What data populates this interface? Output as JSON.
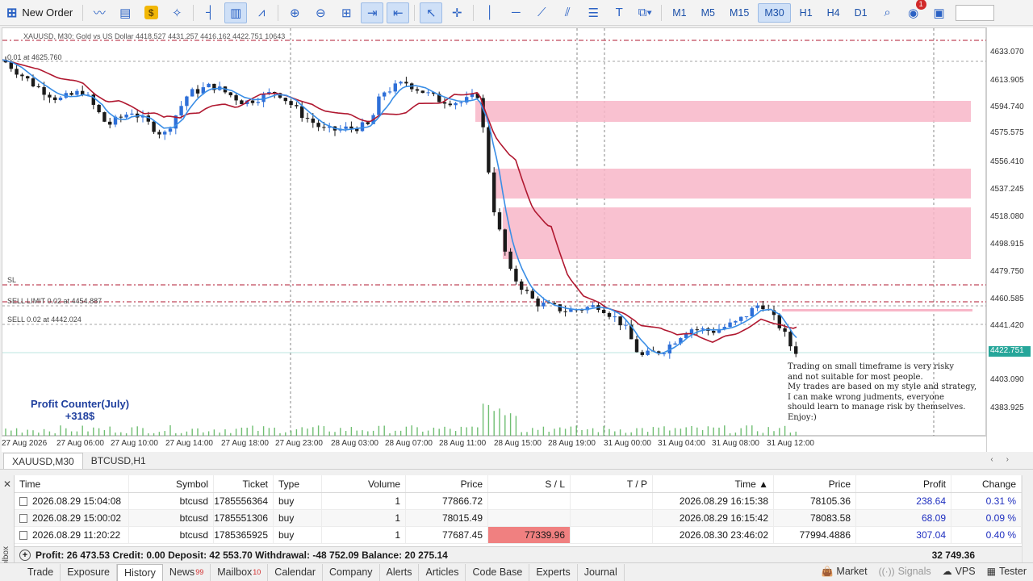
{
  "toolbar": {
    "new_order": "New Order",
    "timeframes": [
      "M1",
      "M5",
      "M15",
      "M30",
      "H1",
      "H4",
      "D1"
    ],
    "active_timeframe": "M30",
    "notification_count": "1"
  },
  "chart": {
    "title": "XAUUSD, M30:  Gold vs US Dollar  4418.527 4431.257 4416.162 4422.751  10643",
    "buy_label": "0.01 at 4625.760",
    "sl_label": "SL",
    "sell_limit_label": "SELL LIMIT 0.02 at 4454.887",
    "sell_label": "SELL 0.02 at 4442.024",
    "profit_counter_title": "Profit Counter(July)",
    "profit_counter_value": "+318$",
    "comment_lines": [
      "Trading on small timeframe is very risky",
      "and not suitable for most people.",
      "My trades are based on my style and strategy,",
      "I can make wrong judments, everyone",
      "should learn to manage risk by themselves.",
      "Enjoy:)"
    ],
    "price_ticks": [
      "4633.070",
      "4613.905",
      "4594.740",
      "4575.575",
      "4556.410",
      "4537.245",
      "4518.080",
      "4498.915",
      "4479.750",
      "4460.585",
      "4441.420",
      "4403.090",
      "4383.925"
    ],
    "current_price": "4422.751",
    "time_ticks": [
      "27 Aug 2026",
      "27 Aug 06:00",
      "27 Aug 10:00",
      "27 Aug 14:00",
      "27 Aug 18:00",
      "27 Aug 23:00",
      "28 Aug 03:00",
      "28 Aug 07:00",
      "28 Aug 11:00",
      "28 Aug 15:00",
      "28 Aug 19:00",
      "31 Aug 00:00",
      "31 Aug 04:00",
      "31 Aug 08:00",
      "31 Aug 12:00"
    ],
    "colors": {
      "bull": "#2e6fd8",
      "bear": "#1a1a1a",
      "fast_ma": "#3a8ee6",
      "slow_ma": "#b01830",
      "zone": "#f8b6c8",
      "current": "#26a69a"
    }
  },
  "chart_tabs": [
    "XAUUSD,M30",
    "BTCUSD,H1"
  ],
  "history": {
    "columns": [
      "Time",
      "Symbol",
      "Ticket",
      "Type",
      "Volume",
      "Price",
      "S / L",
      "T / P",
      "Time",
      "Price",
      "Profit",
      "Change"
    ],
    "rows": [
      [
        "2026.08.29 15:04:08",
        "btcusd",
        "1785556364",
        "buy",
        "1",
        "77866.72",
        "",
        "",
        "2026.08.29 16:15:38",
        "78105.36",
        "238.64",
        "0.31 %"
      ],
      [
        "2026.08.29 15:00:02",
        "btcusd",
        "1785551306",
        "buy",
        "1",
        "78015.49",
        "",
        "",
        "2026.08.29 16:15:42",
        "78083.58",
        "68.09",
        "0.09 %"
      ],
      [
        "2026.08.29 11:20:22",
        "btcusd",
        "1785365925",
        "buy",
        "1",
        "77687.45",
        "77339.96",
        "",
        "2026.08.30 23:46:02",
        "77994.4886",
        "307.04",
        "0.40 %"
      ]
    ],
    "summary": "Profit: 26 473.53  Credit: 0.00  Deposit: 42 553.70  Withdrawal: -48 752.09  Balance: 20 275.14",
    "summary_total": "32 749.36",
    "toolbox_label": "Toolbox"
  },
  "bottom_tabs": [
    {
      "label": "Trade",
      "badge": ""
    },
    {
      "label": "Exposure",
      "badge": ""
    },
    {
      "label": "History",
      "badge": ""
    },
    {
      "label": "News",
      "badge": "99"
    },
    {
      "label": "Mailbox",
      "badge": "10"
    },
    {
      "label": "Calendar",
      "badge": ""
    },
    {
      "label": "Company",
      "badge": ""
    },
    {
      "label": "Alerts",
      "badge": ""
    },
    {
      "label": "Articles",
      "badge": ""
    },
    {
      "label": "Code Base",
      "badge": ""
    },
    {
      "label": "Experts",
      "badge": ""
    },
    {
      "label": "Journal",
      "badge": ""
    }
  ],
  "status_right": {
    "market": "Market",
    "signals": "Signals",
    "vps": "VPS",
    "tester": "Tester"
  }
}
